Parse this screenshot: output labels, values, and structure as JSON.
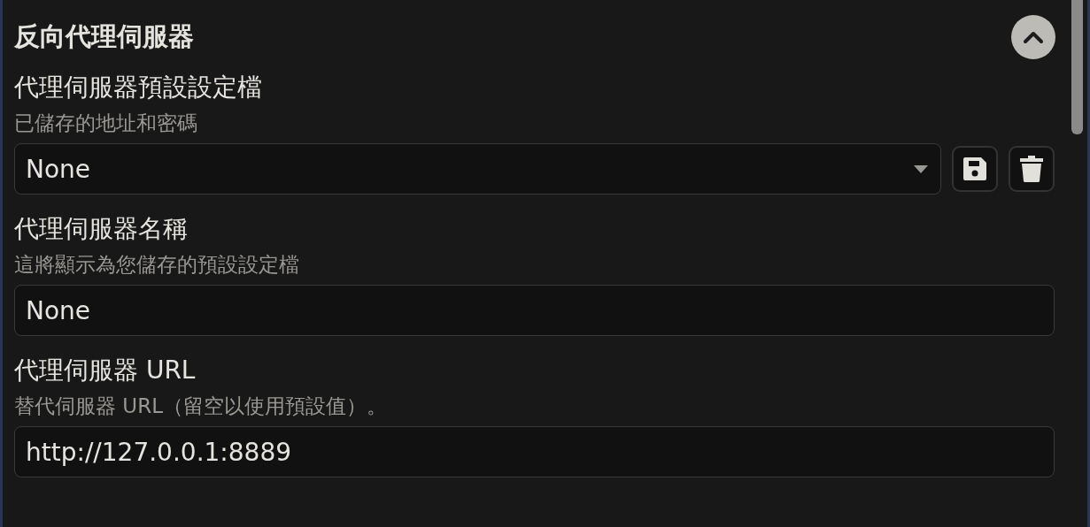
{
  "section": {
    "title": "反向代理伺服器",
    "expanded": true
  },
  "fields": [
    {
      "kind": "select",
      "label": "代理伺服器預設設定檔",
      "hint": "已儲存的地址和密碼",
      "value": "None"
    },
    {
      "kind": "text",
      "label": "代理伺服器名稱",
      "hint": "這將顯示為您儲存的預設設定檔",
      "value": "None"
    },
    {
      "kind": "text",
      "label": "代理伺服器 URL",
      "hint": "替代伺服器 URL（留空以使用預設值）。",
      "value": "http://127.0.0.1:8889"
    }
  ]
}
